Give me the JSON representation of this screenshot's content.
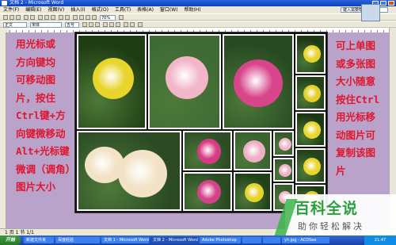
{
  "window": {
    "title": "文档 2 - Microsoft Word"
  },
  "menubar": {
    "items": [
      "文件(F)",
      "编辑(E)",
      "视图(V)",
      "插入(I)",
      "格式(O)",
      "工具(T)",
      "表格(A)",
      "窗口(W)",
      "帮助(H)"
    ],
    "help_placeholder": "键入需要帮助的问题"
  },
  "toolbar": {
    "style_combo": "正文",
    "font_combo": "宋体",
    "size_combo": "五号",
    "zoom_combo": "70%"
  },
  "instructions": {
    "left_lines": [
      "用光标或",
      "方向键均",
      "可移动图",
      "片，按住",
      "Ctrl键+方",
      "向键微移动",
      "Alt+光标键",
      "微调（调角）",
      "图片大小"
    ],
    "right_lines": [
      "可上单图",
      "或多张图",
      "大小随意",
      "按住Ctrl",
      "用光标移",
      "动图片可",
      "复制该图",
      "片"
    ]
  },
  "photos": [
    {
      "flower": "yellow-rose",
      "color": "#e8d42a",
      "bg": "#1f3d12"
    },
    {
      "flower": "pink-rose",
      "color": "#f2b6c8",
      "bg": "#3f6a34"
    },
    {
      "flower": "magenta-rose",
      "color": "#d8458a",
      "bg": "#284a22"
    },
    {
      "flower": "yellow-rose",
      "color": "#e6d52c",
      "bg": "#1d3812"
    },
    {
      "flower": "yellow-rose",
      "color": "#e3cf27",
      "bg": "#23401a"
    },
    {
      "flower": "yellow-rose",
      "color": "#e7d831",
      "bg": "#1b3610"
    },
    {
      "flower": "yellow-rose",
      "color": "#e9d52b",
      "bg": "#24421a"
    },
    {
      "flower": "yellow-rose",
      "color": "#e4d029",
      "bg": "#1e3a14"
    },
    {
      "flower": "white-roses",
      "color": "#f3e3c6",
      "bg": "#2b4a24"
    },
    {
      "flower": "magenta-rose",
      "color": "#d63c85",
      "bg": "#2c4d26"
    },
    {
      "flower": "pink-rose",
      "color": "#efb0c4",
      "bg": "#3a6330"
    },
    {
      "flower": "pink-rose",
      "color": "#f0b8cb",
      "bg": "#375a2d"
    },
    {
      "flower": "magenta-rose",
      "color": "#d4428a",
      "bg": "#2a4a24"
    },
    {
      "flower": "yellow-rose",
      "color": "#e6d32c",
      "bg": "#21401a"
    },
    {
      "flower": "pink-rose",
      "color": "#eeb2c6",
      "bg": "#34592b"
    },
    {
      "flower": "pink-rose",
      "color": "#f1b6c9",
      "bg": "#385c2e"
    }
  ],
  "statusbar": {
    "text": "1 页 1 节 1/1"
  },
  "taskbar": {
    "start_label": "开始",
    "items": [
      "新建文件夹",
      "百度经验",
      "文档 1 - Microsoft Word",
      "文档 2 - Microsoft Word",
      "Adobe Photoshop",
      "",
      "",
      "yh.jpg - ACDSee"
    ],
    "clock": "21:47"
  },
  "watermark": {
    "title": "百科全说",
    "subtitle": "助你轻松解决"
  }
}
